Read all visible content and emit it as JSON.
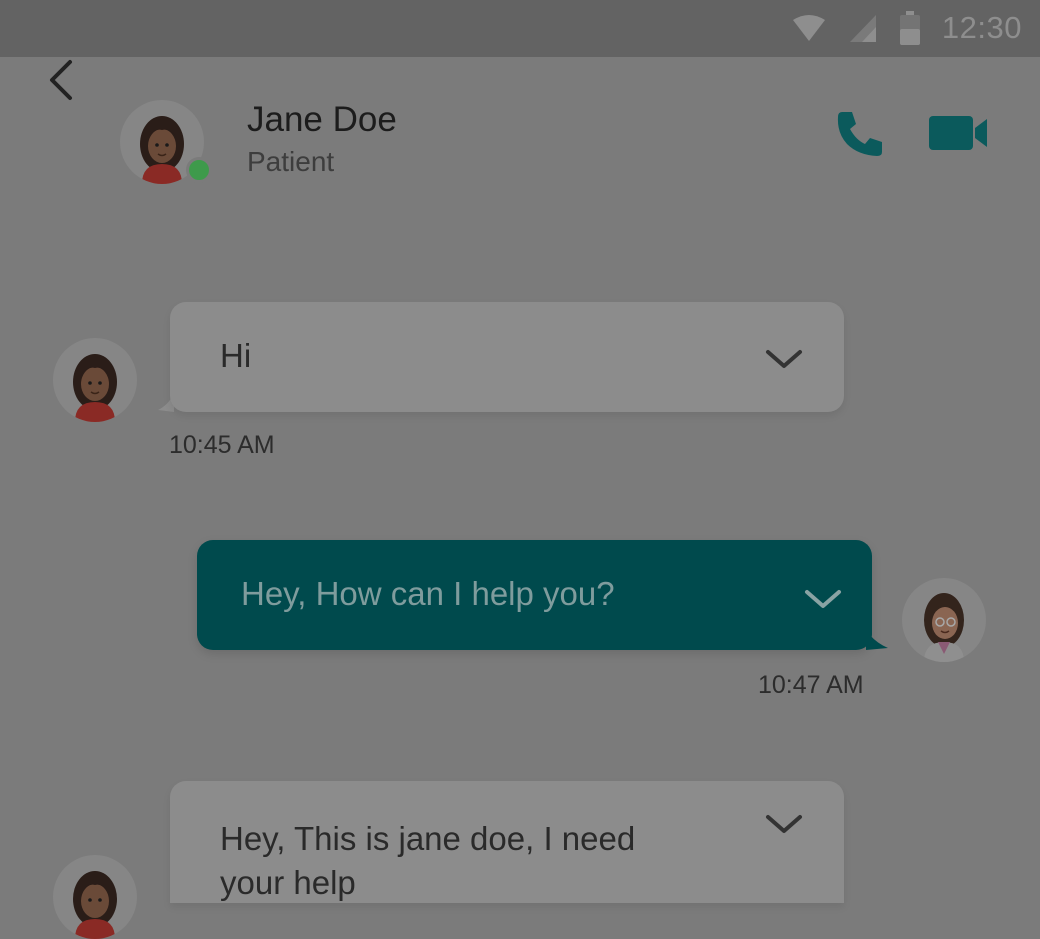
{
  "status_bar": {
    "time": "12:30",
    "icons": [
      "wifi-icon",
      "signal-icon",
      "battery-icon"
    ]
  },
  "header": {
    "contact_name": "Jane Doe",
    "contact_role": "Patient",
    "online": true,
    "icons": [
      "back-icon",
      "phone-icon",
      "video-icon"
    ]
  },
  "messages": [
    {
      "direction": "incoming",
      "text": "Hi",
      "time": "10:45 AM"
    },
    {
      "direction": "outgoing",
      "text": "Hey, How can I help you?",
      "time": "10:47 AM"
    },
    {
      "direction": "incoming",
      "text_lines": [
        "Hey, This is jane doe, I need",
        "your help"
      ]
    }
  ],
  "colors": {
    "accent": "#004a4d",
    "icon_teal": "#0b5a5c",
    "online": "#3e9a4b",
    "overlay_background": "#7b7b7b"
  }
}
